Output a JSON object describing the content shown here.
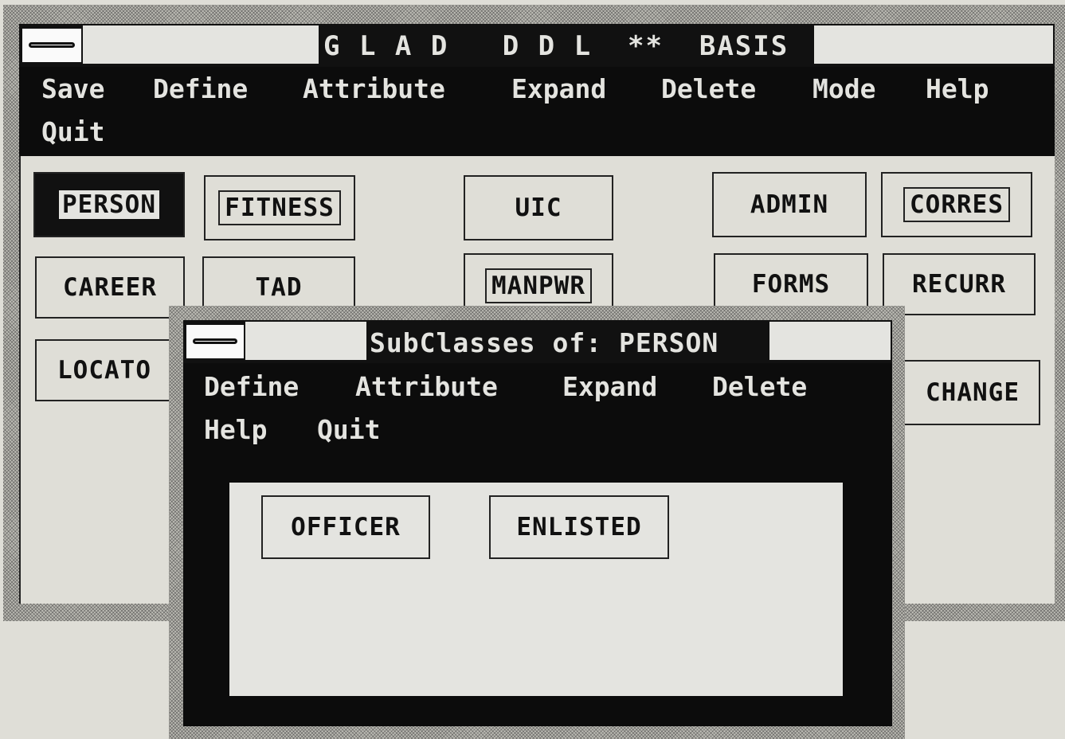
{
  "main_window": {
    "title": "G L A D   D D L  **  BASIS",
    "menu_row1": [
      "Save",
      "Define",
      "Attribute",
      "Expand",
      "Delete",
      "Mode",
      "Help"
    ],
    "menu_row2": [
      "Quit"
    ],
    "classes": {
      "person": "PERSON",
      "fitness": "FITNESS",
      "uic": "UIC",
      "admin": "ADMIN",
      "corres": "CORRES",
      "career": "CAREER",
      "tad": "TAD",
      "manpwr": "MANPWR",
      "forms": "FORMS",
      "recurr": "RECURR",
      "locato": "LOCATO",
      "change": "CHANGE"
    },
    "selected_class": "PERSON"
  },
  "sub_window": {
    "title": "SubClasses of: PERSON",
    "menu_row1": [
      "Define",
      "Attribute",
      "Expand",
      "Delete"
    ],
    "menu_row2": [
      "Help",
      "Quit"
    ],
    "subclasses": {
      "officer": "OFFICER",
      "enlisted": "ENLISTED"
    }
  }
}
